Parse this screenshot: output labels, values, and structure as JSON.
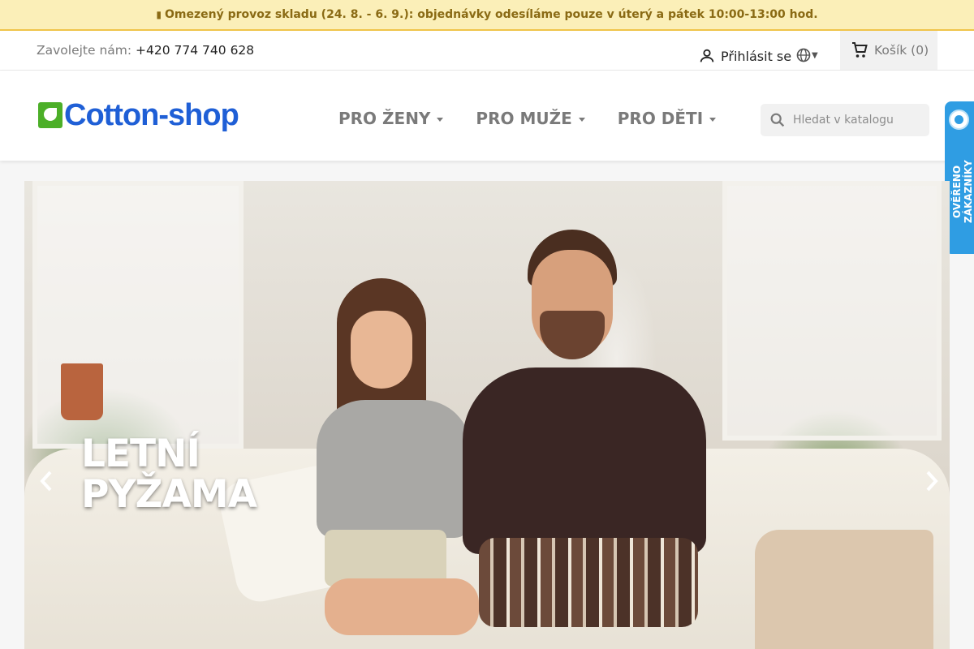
{
  "notice": {
    "icon": "lightning-icon",
    "text": "Omezený provoz skladu (24. 8. - 6. 9.): objednávky odesíláme pouze v úterý a pátek 10:00-13:00 hod."
  },
  "topbar": {
    "call_label": "Zavolejte nám:",
    "phone": "+420 774 740 628",
    "signin_label": "Přihlásit se",
    "language_icon": "globe-icon",
    "cart_label": "Košík",
    "cart_count": "(0)"
  },
  "header": {
    "logo_text": "Cotton-shop",
    "menu": [
      {
        "label": "PRO ŽENY"
      },
      {
        "label": "PRO MUŽE"
      },
      {
        "label": "PRO DĚTI"
      }
    ],
    "search_placeholder": "Hledat v katalogu"
  },
  "badge": {
    "text": "OVĚŘENO ZÁKAZNÍKY"
  },
  "hero": {
    "title_line1": "LETNÍ",
    "title_line2": "PYŽAMA"
  },
  "colors": {
    "accent": "#1f5fd6",
    "brand_green": "#4caf28",
    "notice_bg": "#fbefb8",
    "badge_blue": "#2f9de3"
  }
}
